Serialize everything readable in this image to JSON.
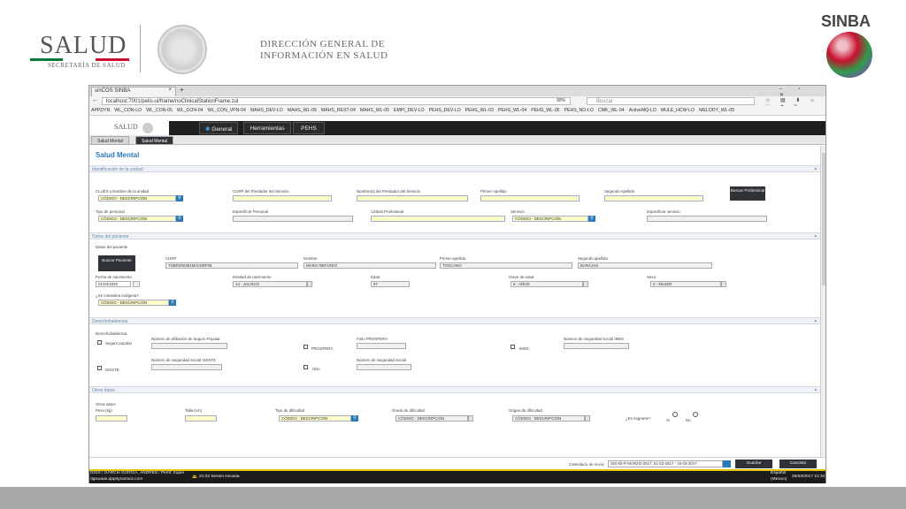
{
  "slide": {
    "salud": "SALUD",
    "salud_sub": "SECRETARÍA DE SALUD",
    "dgis_line1": "DIRECCIÓN GENERAL DE",
    "dgis_line2": "INFORMACIÓN EN SALUD",
    "sinba": "SINBA"
  },
  "browser": {
    "tab_title": "sinCOS SINBA",
    "tab_close": "×",
    "new_tab": "+",
    "url": "localhost:7001/pelis-ui/frame/noClinicalStationFrame.zul",
    "zoom": "90%",
    "search_placeholder": "Buscar",
    "bookmarks": [
      "APPDYN",
      "WL_CON-LO",
      "WL_CON-05",
      "WL_CON-04",
      "WL_CON_VPN-04",
      "MAHS_DEV-LO",
      "MAHS_WL-05",
      "MAHS_REST-04",
      "MAHS_WL-05",
      "EMPI_DEV-LO",
      "PEHS_DEV-LO",
      "PEHS_WL-03",
      "PEHS_WL-04",
      "PEHS_WL-05",
      "PEHS_NO-LO",
      "CMK_WL-04",
      "ActiveMQ-LO",
      "MULE_HCW-LO",
      "MELODY_WL-05"
    ]
  },
  "app": {
    "logo": "SALUD",
    "nav": [
      "General",
      "Herramientas",
      "PEHS"
    ],
    "tabs": [
      "Salud Mental",
      "Salud Mental"
    ],
    "page_title": "Salud Mental"
  },
  "sections": {
    "s1": "Identificación de la unidad",
    "s2": "Datos del paciente",
    "s3": "Derechohabiencia",
    "s4": "Otros datos"
  },
  "unidad": {
    "clues_label": "CLUES y Nombre de la unidad",
    "clues_ph": "CÓDIGO - DESCRIPCIÓN",
    "curp_label": "CURP del Prestador del Servicio",
    "nombre_label": "Nombre(s) del Prestador del Servicio",
    "ap1_label": "Primer Apellido",
    "ap2_label": "Segundo Apellido",
    "buscar_prof": "Buscar Profesional",
    "tipo_label": "Tipo de personal",
    "tipo_ph": "CÓDIGO - DESCRIPCIÓN",
    "esp_label": "Especificar Personal",
    "cedula_label": "Cédula Profesional",
    "servicio_label": "Servicio",
    "servicio_ph": "CÓDIGO - DESCRIPCIÓN",
    "esp_serv_label": "Especificar servicio"
  },
  "paciente": {
    "datos_label": "Datos del paciente",
    "buscar_pac": "Buscar Paciente",
    "curp_label": "CURP",
    "curp": "TOBR200361MJCSRF06",
    "nombre_label": "Nombre",
    "nombre": "MARIA REFUGIO",
    "ap1_label": "Primer apellido",
    "ap1": "TOSCANO",
    "ap2_label": "Segundo apellido",
    "ap2": "BARAJAS",
    "fnac_label": "Fecha de nacimiento",
    "fnac": "01/03/1920",
    "entidad_label": "Entidad de nacimiento",
    "entidad": "14 - JALISCO",
    "edad_label": "Edad",
    "edad": "97",
    "clave_label": "Clave de edad",
    "clave": "5 - AÑOS",
    "sexo_label": "Sexo",
    "sexo": "2 - MUJER",
    "indigena_label": "¿Se considera indígena?",
    "indigena_ph": "CÓDIGO - DESCRIPCIÓN"
  },
  "derecho": {
    "label": "Derechohabiencia",
    "seguro": "Seguro popular",
    "afil_label": "Número de afiliación de Seguro Popular",
    "prospera": "PROSPERA",
    "folio_label": "Folio PROSPERA",
    "imss": "IMSS",
    "nss_imss_label": "Número de Seguridad Social IMSS",
    "issste": "ISSSTE",
    "nss_issste_label": "Número de Seguridad Social ISSSTE",
    "otro": "Otro",
    "nss_label": "Número de Seguridad Social"
  },
  "otros": {
    "label": "Otros datos",
    "peso_label": "Peso (kg)",
    "talla_label": "Talla (cm)",
    "tipo_dif_label": "Tipo de dificultad",
    "tipo_dif_ph": "CÓDIGO - DESCRIPCIÓN",
    "grado_label": "Grado de dificultad",
    "grado_ph": "CÓDIGO - DESCRIPCIÓN",
    "origen_label": "Origen de dificultad",
    "origen_ph": "CÓDIGO - DESCRIPCIÓN",
    "migrante_label": "¿Es migrante?",
    "si": "Si",
    "no": "No"
  },
  "footer": {
    "cal_label": "Calendario de envío:",
    "cal_value": "SIS-83-P-MARZO-2017: 01-03-2017 - 15-03-2017",
    "guardar": "Guardar",
    "cancelar": "Cancelar"
  },
  "status": {
    "user": "DGIS / GARCIA GARCIA, ANDRES / Perfil: Super",
    "host": "dgisuaas.appdynamics.com",
    "session": "21:32 Sesión iniciada",
    "lang1": "Español",
    "lang2": "(Mexico)",
    "datetime": "28/03/2017 21:34"
  }
}
